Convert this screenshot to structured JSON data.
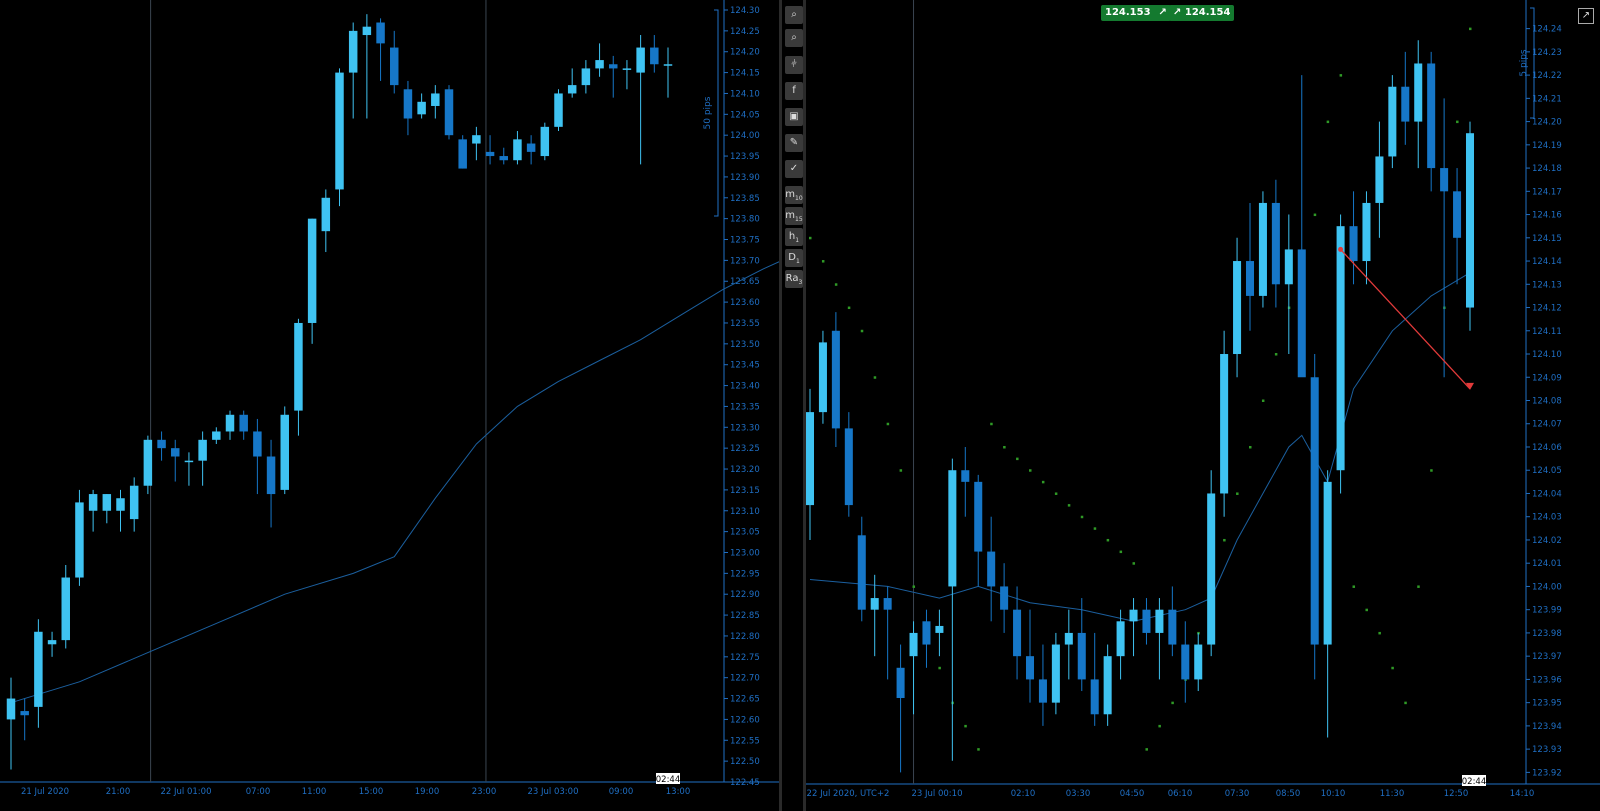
{
  "colors": {
    "bull": "#3fc3f2",
    "bear": "#1677c8",
    "axis": "#1f6fc4",
    "ma": "#1b5f9e",
    "psar": "#2f9a26",
    "arrow": "#e23a3a",
    "badge": "#147a2f"
  },
  "left_panel": {
    "scale_label": "50 pips",
    "time_tag": "02:44",
    "x_labels": [
      "21 Jul 2020",
      "21:00",
      "22 Jul 01:00",
      "07:00",
      "11:00",
      "15:00",
      "19:00",
      "23:00",
      "23 Jul 03:00",
      "09:00",
      "13:00"
    ],
    "y_ticks": [
      "124.30",
      "124.25",
      "124.20",
      "124.15",
      "124.10",
      "124.05",
      "124.00",
      "123.95",
      "123.90",
      "123.85",
      "123.80",
      "123.75",
      "123.70",
      "123.65",
      "123.60",
      "123.55",
      "123.50",
      "123.45",
      "123.40",
      "123.35",
      "123.30",
      "123.25",
      "123.20",
      "123.15",
      "123.10",
      "123.05",
      "123.00",
      "122.95",
      "122.90",
      "122.85",
      "122.80",
      "122.75",
      "122.70",
      "122.65",
      "122.60",
      "122.55",
      "122.50",
      "122.45"
    ]
  },
  "right_panel": {
    "scale_label": "5 pips",
    "time_tag": "02:44",
    "sell_price": "124.153",
    "buy_price": "124.154",
    "x_labels": [
      "22 Jul 2020, UTC+2",
      "23 Jul 00:10",
      "02:10",
      "03:30",
      "04:50",
      "06:10",
      "07:30",
      "08:50",
      "10:10",
      "11:30",
      "12:50",
      "14:10"
    ],
    "y_ticks": [
      "124.24",
      "124.23",
      "124.22",
      "124.21",
      "124.20",
      "124.19",
      "124.18",
      "124.17",
      "124.16",
      "124.15",
      "124.14",
      "124.13",
      "124.12",
      "124.11",
      "124.10",
      "124.09",
      "124.08",
      "124.07",
      "124.06",
      "124.05",
      "124.04",
      "124.03",
      "124.02",
      "124.01",
      "124.00",
      "123.99",
      "123.98",
      "123.97",
      "123.96",
      "123.95",
      "123.94",
      "123.93",
      "123.92"
    ]
  },
  "toolbar": {
    "buttons": [
      "zoom-in",
      "zoom-out",
      "indicators",
      "facebook",
      "share",
      "drawings",
      "screenshot",
      "m10",
      "m15",
      "h1",
      "D1",
      "Ra3"
    ]
  },
  "chart_data": [
    {
      "type": "candlestick",
      "title": "",
      "xlabel": "",
      "ylabel": "",
      "ylim": [
        122.45,
        124.3
      ],
      "candles": [
        {
          "o": 122.6,
          "h": 122.7,
          "l": 122.48,
          "c": 122.65
        },
        {
          "o": 122.62,
          "h": 122.65,
          "l": 122.55,
          "c": 122.61
        },
        {
          "o": 122.63,
          "h": 122.84,
          "l": 122.58,
          "c": 122.81
        },
        {
          "o": 122.78,
          "h": 122.81,
          "l": 122.75,
          "c": 122.79
        },
        {
          "o": 122.79,
          "h": 122.97,
          "l": 122.77,
          "c": 122.94
        },
        {
          "o": 122.94,
          "h": 123.15,
          "l": 122.92,
          "c": 123.12
        },
        {
          "o": 123.1,
          "h": 123.15,
          "l": 123.05,
          "c": 123.14
        },
        {
          "o": 123.1,
          "h": 123.14,
          "l": 123.07,
          "c": 123.14
        },
        {
          "o": 123.1,
          "h": 123.15,
          "l": 123.05,
          "c": 123.13
        },
        {
          "o": 123.08,
          "h": 123.18,
          "l": 123.05,
          "c": 123.16
        },
        {
          "o": 123.16,
          "h": 123.28,
          "l": 123.14,
          "c": 123.27
        },
        {
          "o": 123.27,
          "h": 123.29,
          "l": 123.22,
          "c": 123.25
        },
        {
          "o": 123.25,
          "h": 123.27,
          "l": 123.17,
          "c": 123.23
        },
        {
          "o": 123.22,
          "h": 123.24,
          "l": 123.16,
          "c": 123.22
        },
        {
          "o": 123.22,
          "h": 123.29,
          "l": 123.16,
          "c": 123.27
        },
        {
          "o": 123.27,
          "h": 123.3,
          "l": 123.26,
          "c": 123.29
        },
        {
          "o": 123.29,
          "h": 123.34,
          "l": 123.27,
          "c": 123.33
        },
        {
          "o": 123.33,
          "h": 123.34,
          "l": 123.27,
          "c": 123.29
        },
        {
          "o": 123.29,
          "h": 123.32,
          "l": 123.14,
          "c": 123.23
        },
        {
          "o": 123.23,
          "h": 123.27,
          "l": 123.06,
          "c": 123.14
        },
        {
          "o": 123.15,
          "h": 123.35,
          "l": 123.14,
          "c": 123.33
        },
        {
          "o": 123.34,
          "h": 123.56,
          "l": 123.28,
          "c": 123.55
        },
        {
          "o": 123.55,
          "h": 123.8,
          "l": 123.5,
          "c": 123.8
        },
        {
          "o": 123.77,
          "h": 123.87,
          "l": 123.72,
          "c": 123.85
        },
        {
          "o": 123.87,
          "h": 124.16,
          "l": 123.83,
          "c": 124.15
        },
        {
          "o": 124.15,
          "h": 124.27,
          "l": 124.04,
          "c": 124.25
        },
        {
          "o": 124.24,
          "h": 124.29,
          "l": 124.04,
          "c": 124.26
        },
        {
          "o": 124.27,
          "h": 124.28,
          "l": 124.13,
          "c": 124.22
        },
        {
          "o": 124.21,
          "h": 124.25,
          "l": 124.1,
          "c": 124.12
        },
        {
          "o": 124.11,
          "h": 124.13,
          "l": 124.0,
          "c": 124.04
        },
        {
          "o": 124.05,
          "h": 124.1,
          "l": 124.04,
          "c": 124.08
        },
        {
          "o": 124.07,
          "h": 124.12,
          "l": 124.04,
          "c": 124.1
        },
        {
          "o": 124.11,
          "h": 124.12,
          "l": 123.99,
          "c": 124.0
        },
        {
          "o": 123.99,
          "h": 124.0,
          "l": 123.92,
          "c": 123.92
        },
        {
          "o": 123.98,
          "h": 124.02,
          "l": 123.94,
          "c": 124.0
        },
        {
          "o": 123.96,
          "h": 124.0,
          "l": 123.93,
          "c": 123.95
        },
        {
          "o": 123.95,
          "h": 123.97,
          "l": 123.93,
          "c": 123.94
        },
        {
          "o": 123.94,
          "h": 124.01,
          "l": 123.93,
          "c": 123.99
        },
        {
          "o": 123.98,
          "h": 124.0,
          "l": 123.93,
          "c": 123.96
        },
        {
          "o": 123.95,
          "h": 124.03,
          "l": 123.94,
          "c": 124.02
        },
        {
          "o": 124.02,
          "h": 124.11,
          "l": 124.01,
          "c": 124.1
        },
        {
          "o": 124.1,
          "h": 124.16,
          "l": 124.09,
          "c": 124.12
        },
        {
          "o": 124.12,
          "h": 124.18,
          "l": 124.1,
          "c": 124.16
        },
        {
          "o": 124.16,
          "h": 124.22,
          "l": 124.14,
          "c": 124.18
        },
        {
          "o": 124.17,
          "h": 124.19,
          "l": 124.09,
          "c": 124.16
        },
        {
          "o": 124.16,
          "h": 124.18,
          "l": 124.11,
          "c": 124.16
        },
        {
          "o": 124.15,
          "h": 124.24,
          "l": 123.93,
          "c": 124.21
        },
        {
          "o": 124.21,
          "h": 124.24,
          "l": 124.15,
          "c": 124.17
        },
        {
          "o": 124.17,
          "h": 124.21,
          "l": 124.09,
          "c": 124.17
        }
      ],
      "moving_average": [
        [
          0,
          122.64
        ],
        [
          5,
          122.69
        ],
        [
          10,
          122.76
        ],
        [
          15,
          122.83
        ],
        [
          20,
          122.9
        ],
        [
          25,
          122.95
        ],
        [
          28,
          122.99
        ],
        [
          31,
          123.13
        ],
        [
          34,
          123.26
        ],
        [
          37,
          123.35
        ],
        [
          40,
          123.41
        ],
        [
          43,
          123.46
        ],
        [
          46,
          123.51
        ],
        [
          49,
          123.57
        ],
        [
          52,
          123.63
        ],
        [
          55,
          123.68
        ],
        [
          57,
          123.71
        ]
      ]
    },
    {
      "type": "candlestick",
      "title": "",
      "xlabel": "",
      "ylabel": "",
      "ylim": [
        123.915,
        124.245
      ],
      "candles": [
        {
          "o": 124.035,
          "h": 124.085,
          "l": 124.02,
          "c": 124.075
        },
        {
          "o": 124.075,
          "h": 124.11,
          "l": 124.07,
          "c": 124.105
        },
        {
          "o": 124.11,
          "h": 124.118,
          "l": 124.06,
          "c": 124.068
        },
        {
          "o": 124.068,
          "h": 124.075,
          "l": 124.03,
          "c": 124.035
        },
        {
          "o": 124.022,
          "h": 124.03,
          "l": 123.985,
          "c": 123.99
        },
        {
          "o": 123.99,
          "h": 124.005,
          "l": 123.97,
          "c": 123.995
        },
        {
          "o": 123.995,
          "h": 124.0,
          "l": 123.96,
          "c": 123.99
        },
        {
          "o": 123.965,
          "h": 123.975,
          "l": 123.92,
          "c": 123.952
        },
        {
          "o": 123.97,
          "h": 123.985,
          "l": 123.945,
          "c": 123.98
        },
        {
          "o": 123.985,
          "h": 123.99,
          "l": 123.965,
          "c": 123.975
        },
        {
          "o": 123.98,
          "h": 123.99,
          "l": 123.97,
          "c": 123.983
        },
        {
          "o": 124.0,
          "h": 124.055,
          "l": 123.925,
          "c": 124.05
        },
        {
          "o": 124.05,
          "h": 124.06,
          "l": 124.03,
          "c": 124.045
        },
        {
          "o": 124.045,
          "h": 124.048,
          "l": 124.0,
          "c": 124.015
        },
        {
          "o": 124.015,
          "h": 124.03,
          "l": 123.985,
          "c": 124.0
        },
        {
          "o": 124.0,
          "h": 124.01,
          "l": 123.98,
          "c": 123.99
        },
        {
          "o": 123.99,
          "h": 124.0,
          "l": 123.96,
          "c": 123.97
        },
        {
          "o": 123.97,
          "h": 123.99,
          "l": 123.95,
          "c": 123.96
        },
        {
          "o": 123.96,
          "h": 123.975,
          "l": 123.94,
          "c": 123.95
        },
        {
          "o": 123.95,
          "h": 123.98,
          "l": 123.945,
          "c": 123.975
        },
        {
          "o": 123.975,
          "h": 123.99,
          "l": 123.96,
          "c": 123.98
        },
        {
          "o": 123.98,
          "h": 123.995,
          "l": 123.955,
          "c": 123.96
        },
        {
          "o": 123.96,
          "h": 123.98,
          "l": 123.94,
          "c": 123.945
        },
        {
          "o": 123.945,
          "h": 123.975,
          "l": 123.94,
          "c": 123.97
        },
        {
          "o": 123.97,
          "h": 123.99,
          "l": 123.96,
          "c": 123.985
        },
        {
          "o": 123.985,
          "h": 123.995,
          "l": 123.97,
          "c": 123.99
        },
        {
          "o": 123.99,
          "h": 123.995,
          "l": 123.975,
          "c": 123.98
        },
        {
          "o": 123.98,
          "h": 123.995,
          "l": 123.96,
          "c": 123.99
        },
        {
          "o": 123.99,
          "h": 124.0,
          "l": 123.97,
          "c": 123.975
        },
        {
          "o": 123.975,
          "h": 123.985,
          "l": 123.95,
          "c": 123.96
        },
        {
          "o": 123.96,
          "h": 123.98,
          "l": 123.955,
          "c": 123.975
        },
        {
          "o": 123.975,
          "h": 124.05,
          "l": 123.97,
          "c": 124.04
        },
        {
          "o": 124.04,
          "h": 124.11,
          "l": 124.03,
          "c": 124.1
        },
        {
          "o": 124.1,
          "h": 124.15,
          "l": 124.09,
          "c": 124.14
        },
        {
          "o": 124.14,
          "h": 124.165,
          "l": 124.11,
          "c": 124.125
        },
        {
          "o": 124.125,
          "h": 124.17,
          "l": 124.12,
          "c": 124.165
        },
        {
          "o": 124.165,
          "h": 124.175,
          "l": 124.12,
          "c": 124.13
        },
        {
          "o": 124.13,
          "h": 124.16,
          "l": 124.1,
          "c": 124.145
        },
        {
          "o": 124.145,
          "h": 124.22,
          "l": 124.1,
          "c": 124.09
        },
        {
          "o": 124.09,
          "h": 124.1,
          "l": 123.96,
          "c": 123.975
        },
        {
          "o": 123.975,
          "h": 124.05,
          "l": 123.935,
          "c": 124.045
        },
        {
          "o": 124.05,
          "h": 124.16,
          "l": 124.04,
          "c": 124.155
        },
        {
          "o": 124.155,
          "h": 124.17,
          "l": 124.13,
          "c": 124.14
        },
        {
          "o": 124.14,
          "h": 124.17,
          "l": 124.13,
          "c": 124.165
        },
        {
          "o": 124.165,
          "h": 124.2,
          "l": 124.15,
          "c": 124.185
        },
        {
          "o": 124.185,
          "h": 124.22,
          "l": 124.18,
          "c": 124.215
        },
        {
          "o": 124.215,
          "h": 124.23,
          "l": 124.19,
          "c": 124.2
        },
        {
          "o": 124.2,
          "h": 124.235,
          "l": 124.18,
          "c": 124.225
        },
        {
          "o": 124.225,
          "h": 124.23,
          "l": 124.17,
          "c": 124.18
        },
        {
          "o": 124.18,
          "h": 124.21,
          "l": 124.09,
          "c": 124.17
        },
        {
          "o": 124.17,
          "h": 124.18,
          "l": 124.13,
          "c": 124.15
        },
        {
          "o": 124.12,
          "h": 124.2,
          "l": 124.11,
          "c": 124.195
        }
      ],
      "moving_average": [
        [
          0,
          124.003
        ],
        [
          6,
          124.0
        ],
        [
          10,
          123.995
        ],
        [
          13,
          124.0
        ],
        [
          17,
          123.993
        ],
        [
          21,
          123.99
        ],
        [
          25,
          123.985
        ],
        [
          29,
          123.99
        ],
        [
          31,
          123.995
        ],
        [
          33,
          124.02
        ],
        [
          35,
          124.04
        ],
        [
          37,
          124.06
        ],
        [
          38,
          124.065
        ],
        [
          40,
          124.045
        ],
        [
          42,
          124.085
        ],
        [
          45,
          124.11
        ],
        [
          48,
          124.125
        ],
        [
          51,
          124.135
        ]
      ],
      "parabolic_sar": [
        124.15,
        124.14,
        124.13,
        124.12,
        124.11,
        124.09,
        124.07,
        124.05,
        124.0,
        123.98,
        123.965,
        123.95,
        123.94,
        123.93,
        124.07,
        124.06,
        124.055,
        124.05,
        124.045,
        124.04,
        124.035,
        124.03,
        124.025,
        124.02,
        124.015,
        124.01,
        123.93,
        123.94,
        123.95,
        123.96,
        123.98,
        124.0,
        124.02,
        124.04,
        124.06,
        124.08,
        124.1,
        124.12,
        124.14,
        124.16,
        124.2,
        124.22,
        124.0,
        123.99,
        123.98,
        123.965,
        123.95,
        124.0,
        124.05,
        124.12,
        124.2,
        124.24
      ],
      "arrow": {
        "from": [
          41,
          124.145
        ],
        "to": [
          51,
          124.085
        ]
      }
    }
  ]
}
